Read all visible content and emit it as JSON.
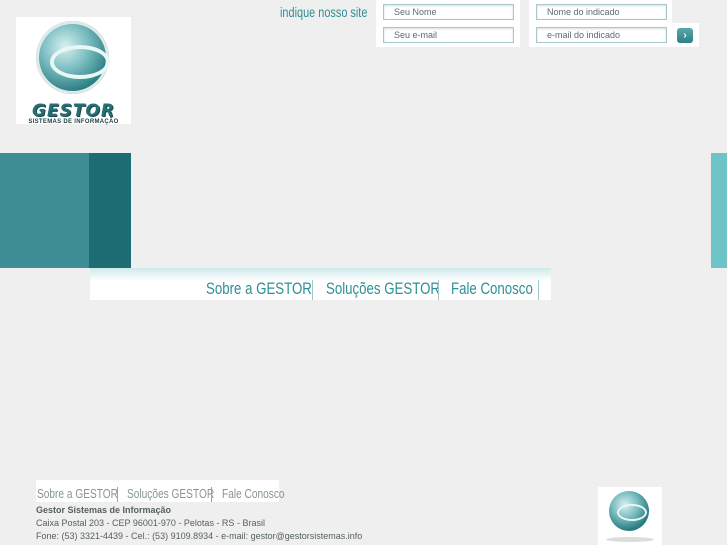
{
  "logo": {
    "brand": "GESTOR",
    "subtitle": "SISTEMAS DE INFORMAÇÃO"
  },
  "indicate_form": {
    "label": "indique nosso site",
    "your_name_placeholder": "Seu Nome",
    "your_email_placeholder": "Seu e-mail",
    "friend_name_placeholder": "Nome do indicado",
    "friend_email_placeholder": "e-mail do indicado",
    "send_icon": "chevron-right-icon",
    "send_glyph": "›"
  },
  "main_nav": {
    "items": [
      {
        "label": "Sobre a GESTOR"
      },
      {
        "label": "Soluções GESTOR"
      },
      {
        "label": "Fale Conosco"
      }
    ]
  },
  "footer": {
    "nav": [
      {
        "label": "Sobre a GESTOR"
      },
      {
        "label": "Soluções GESTOR"
      },
      {
        "label": "Fale Conosco"
      }
    ],
    "company": "Gestor Sistemas de Informação",
    "address": "Caixa Postal 203 - CEP 96001-970 - Pelotas - RS - Brasil",
    "contact": "Fone: (53) 3321-4439 - Cel.: (53) 9109.8934 - e-mail: gestor@gestorsistemas.info"
  },
  "colors": {
    "accent": "#2f8f94",
    "banner_teal": "#3e8f95",
    "banner_dark": "#1e6d74",
    "banner_light": "#6ec3c7",
    "background": "#efefef"
  }
}
